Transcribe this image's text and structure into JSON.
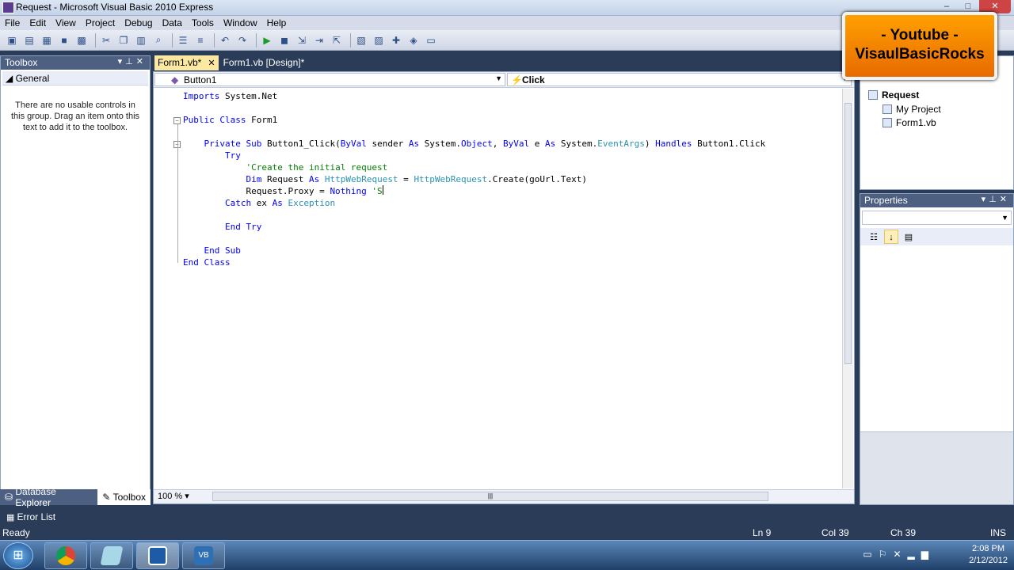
{
  "window": {
    "title": "Request - Microsoft Visual Basic 2010 Express"
  },
  "menu": [
    "File",
    "Edit",
    "View",
    "Project",
    "Debug",
    "Data",
    "Tools",
    "Window",
    "Help"
  ],
  "toolbox": {
    "title": "Toolbox",
    "group": "General",
    "message": "There are no usable controls in this group. Drag an item onto this text to add it to the toolbox.",
    "tabs": [
      "Database Explorer",
      "Toolbox"
    ]
  },
  "editor": {
    "tabs": [
      "Form1.vb*",
      "Form1.vb [Design]*"
    ],
    "nav_left": "Button1",
    "nav_right": "Click",
    "zoom": "100 %"
  },
  "solution": {
    "root": "Request",
    "items": [
      "My Project",
      "Form1.vb"
    ]
  },
  "properties": {
    "title": "Properties"
  },
  "watermark": {
    "line1": "- Youtube -",
    "line2": "VisaulBasicRocks"
  },
  "error_list": "Error List",
  "status": {
    "state": "Ready",
    "ln": "Ln 9",
    "col": "Col 39",
    "ch": "Ch 39",
    "mode": "INS"
  },
  "clock": {
    "time": "2:08 PM",
    "date": "2/12/2012"
  },
  "colors": {
    "keyword": "#0000ff",
    "type": "#2b91af",
    "comment": "#008000",
    "background": "#2b3c59"
  }
}
